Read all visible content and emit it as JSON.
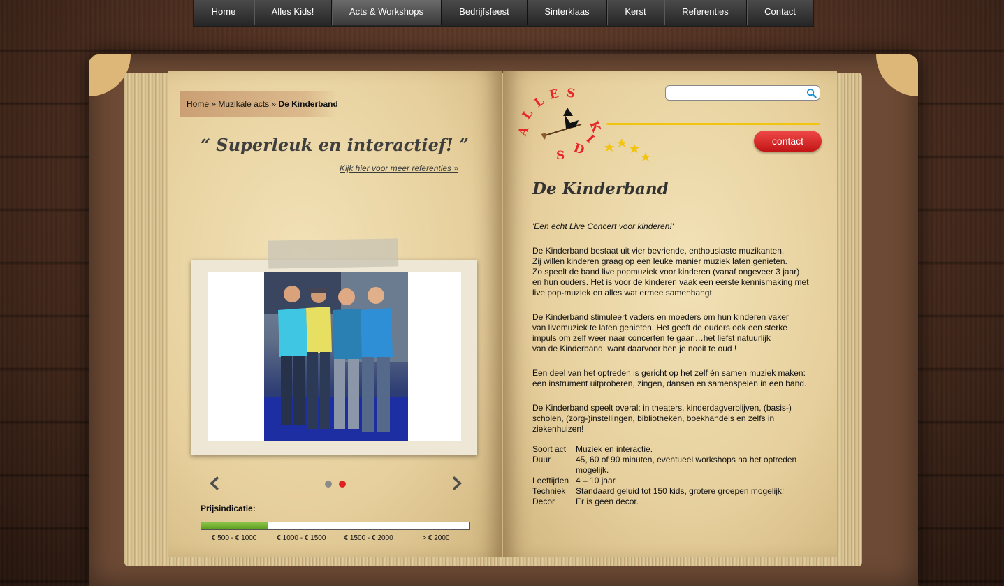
{
  "nav": {
    "items": [
      "Home",
      "Alles Kids!",
      "Acts & Workshops",
      "Bedrijfsfeest",
      "Sinterklaas",
      "Kerst",
      "Referenties",
      "Contact"
    ],
    "active_index": 2
  },
  "breadcrumb": {
    "home": "Home",
    "sep": "»",
    "parent": "Muzikale acts",
    "current": "De Kinderband"
  },
  "quote": "“ Superleuk en interactief! ”",
  "references_link": "Kijk hier voor meer referenties »",
  "slider": {
    "slide_count": 2,
    "active_slide": 2
  },
  "price": {
    "title": "Prijsindicatie:",
    "ranges": [
      "€ 500 - € 1000",
      "€ 1000 - € 1500",
      "€ 1500 - € 2000",
      "> € 2000"
    ],
    "selected_index": 0
  },
  "search": {
    "value": "",
    "placeholder": ""
  },
  "logo": {
    "text": "ALLES KIDS"
  },
  "contact_button": "contact",
  "page_title": "De Kinderband",
  "intro": "'Een echt Live Concert voor kinderen!'",
  "paragraphs": [
    "De Kinderband bestaat uit vier bevriende, enthousiaste muzikanten.",
    "Zij willen kinderen graag op een leuke manier muziek laten genieten.",
    "Zo speelt de band live popmuziek voor kinderen (vanaf ongeveer 3 jaar)",
    "en hun ouders. Het is voor de kinderen vaak een eerste kennismaking met",
    "live pop-muziek en alles wat ermee samenhangt.",
    "De Kinderband stimuleert vaders en moeders om hun kinderen vaker",
    "van livemuziek te laten genieten. Het geeft de ouders ook een sterke",
    "impuls om zelf weer naar concerten te gaan…het liefst natuurlijk",
    "van de Kinderband, want daarvoor ben je nooit te oud !",
    "Een deel van het optreden is gericht op het zelf én samen muziek maken:",
    "een instrument uitproberen, zingen, dansen en samenspelen in een band.",
    "De Kinderband speelt overal: in theaters, kinderdagverblijven, (basis-)",
    "scholen, (zorg-)instellingen, bibliotheken, boekhandels en zelfs in",
    "ziekenhuizen!"
  ],
  "specs": [
    {
      "key": "Soort act",
      "value": "Muziek en interactie."
    },
    {
      "key": "Duur",
      "value": "45, 60 of 90 minuten, eventueel workshops na het optreden mogelijk."
    },
    {
      "key": "Leeftijden",
      "value": "4 – 10 jaar"
    },
    {
      "key": "Techniek",
      "value": "Standaard geluid tot 150 kids, grotere groepen mogelijk!"
    },
    {
      "key": "Decor",
      "value": "Er is geen decor."
    }
  ],
  "colors": {
    "accent_red": "#d22222",
    "price_fill": "#6aaa26",
    "logo_yellow": "#f1c40f"
  }
}
